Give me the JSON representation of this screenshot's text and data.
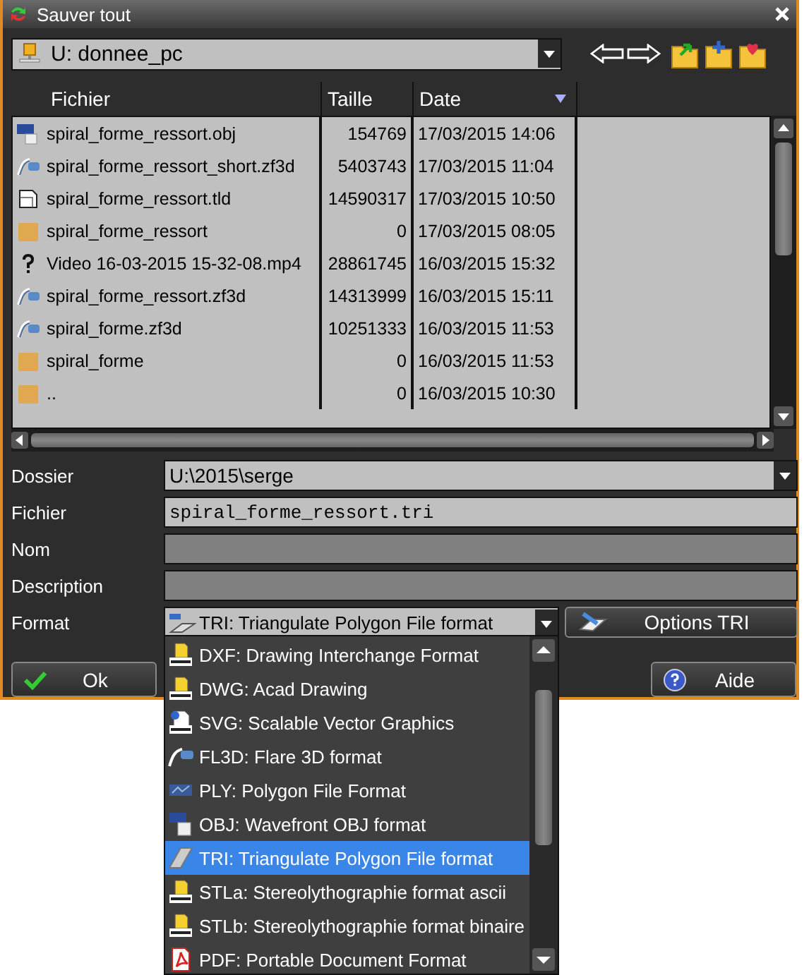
{
  "window": {
    "title": "Sauver tout"
  },
  "drive": {
    "value": "U: donnee_pc"
  },
  "table": {
    "columns": [
      {
        "label": "Fichier",
        "sorted": false
      },
      {
        "label": "Taille",
        "sorted": false
      },
      {
        "label": "Date",
        "sorted": true
      }
    ],
    "rows": [
      {
        "kind": "obj",
        "name": "spiral_forme_ressort.obj",
        "size": "154769",
        "date": "17/03/2015 14:06"
      },
      {
        "kind": "zf3d",
        "name": "spiral_forme_ressort_short.zf3d",
        "size": "5403743",
        "date": "17/03/2015 11:04"
      },
      {
        "kind": "tld",
        "name": "spiral_forme_ressort.tld",
        "size": "14590317",
        "date": "17/03/2015 10:50"
      },
      {
        "kind": "folder",
        "name": "spiral_forme_ressort",
        "size": "0",
        "date": "17/03/2015 08:05"
      },
      {
        "kind": "unknown",
        "name": "Video 16-03-2015 15-32-08.mp4",
        "size": "28861745",
        "date": "16/03/2015 15:32"
      },
      {
        "kind": "zf3d",
        "name": "spiral_forme_ressort.zf3d",
        "size": "14313999",
        "date": "16/03/2015 15:11"
      },
      {
        "kind": "zf3d",
        "name": "spiral_forme.zf3d",
        "size": "10251333",
        "date": "16/03/2015 11:53"
      },
      {
        "kind": "folder",
        "name": "spiral_forme",
        "size": "0",
        "date": "16/03/2015 11:53"
      },
      {
        "kind": "folder",
        "name": "..",
        "size": "0",
        "date": "16/03/2015 10:30"
      }
    ]
  },
  "form": [
    {
      "label": "Dossier",
      "kind": "combo",
      "value": "U:\\2015\\serge"
    },
    {
      "label": "Fichier",
      "kind": "text",
      "value": "spiral_forme_ressort.tri",
      "disabled": false
    },
    {
      "label": "Nom",
      "kind": "text",
      "disabled": true
    },
    {
      "label": "Description",
      "kind": "text",
      "disabled": true
    }
  ],
  "format": {
    "label": "Format",
    "value": "TRI: Triangulate Polygon File format",
    "options_button": "Options TRI"
  },
  "buttons": [
    {
      "label": "Ok",
      "kind": "ok"
    },
    {
      "label": "Aide",
      "kind": "help"
    }
  ],
  "format_list": [
    {
      "kind": "doc",
      "label": "DXF: Drawing Interchange Format",
      "selected": false
    },
    {
      "kind": "doc",
      "label": "DWG: Acad Drawing",
      "selected": false
    },
    {
      "kind": "svg",
      "label": "SVG: Scalable Vector Graphics",
      "selected": false
    },
    {
      "kind": "flare",
      "label": "FL3D: Flare 3D format",
      "selected": false
    },
    {
      "kind": "ply",
      "label": "PLY: Polygon File Format",
      "selected": false
    },
    {
      "kind": "obj",
      "label": "OBJ: Wavefront OBJ format",
      "selected": false
    },
    {
      "kind": "tri",
      "label": "TRI: Triangulate Polygon File format",
      "selected": true
    },
    {
      "kind": "doc",
      "label": "STLa: Stereolythographie format ascii",
      "selected": false
    },
    {
      "kind": "doc",
      "label": "STLb: Stereolythographie format binaire",
      "selected": false
    },
    {
      "kind": "pdf",
      "label": "PDF: Portable Document Format",
      "selected": false
    }
  ]
}
